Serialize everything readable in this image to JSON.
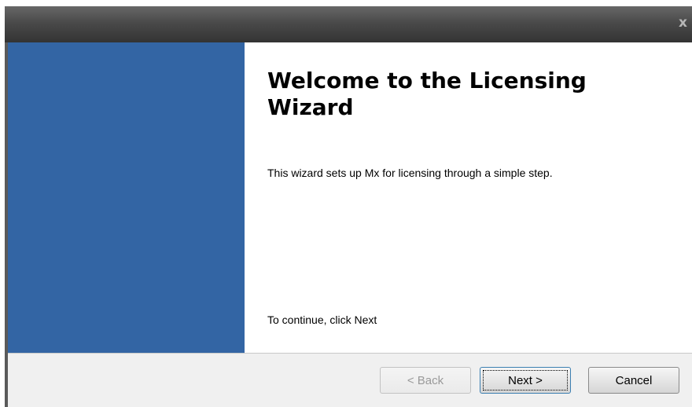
{
  "window": {
    "close_glyph": "x"
  },
  "content": {
    "title": "Welcome to the Licensing Wizard",
    "description": "This wizard sets up Mx for licensing through a simple step.",
    "continue_text": "To continue, click Next"
  },
  "footer": {
    "back_label": "< Back",
    "next_label": "Next >",
    "cancel_label": "Cancel",
    "back_enabled": false
  },
  "colors": {
    "banner": "#3365a4",
    "titlebar": "#4a4a4a",
    "footer": "#f0f0f0"
  },
  "icons": {
    "close": "close-icon"
  }
}
